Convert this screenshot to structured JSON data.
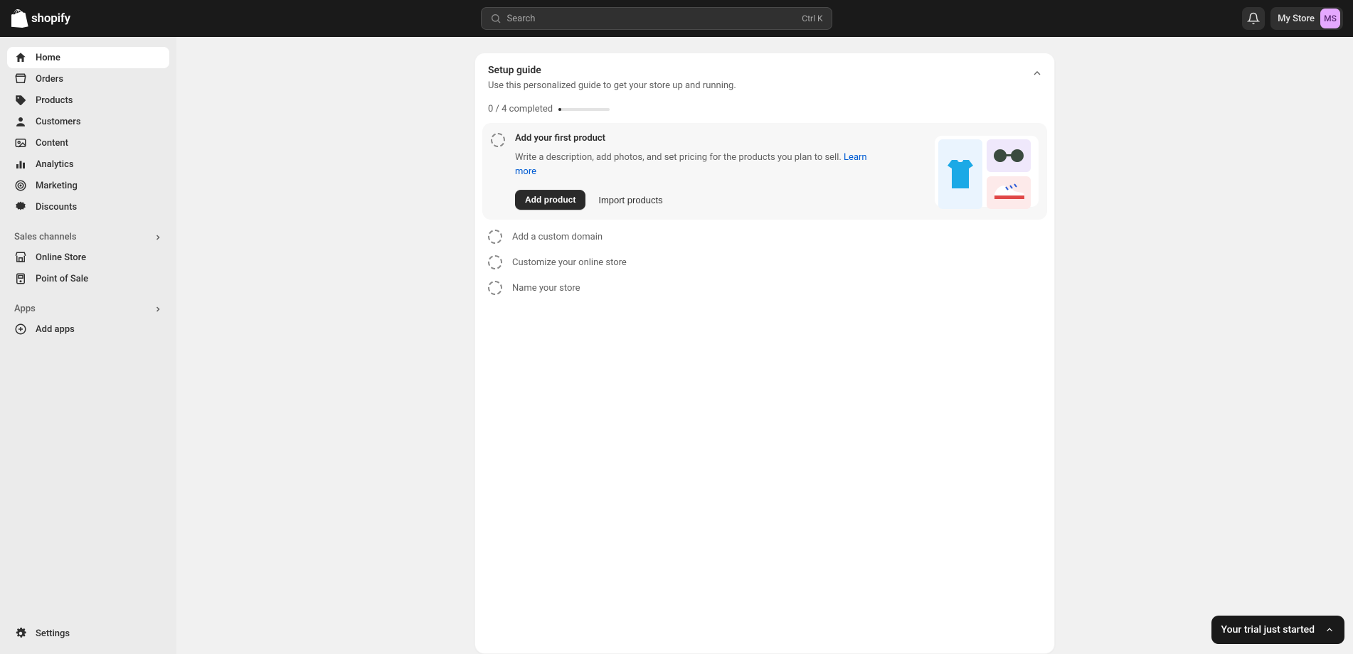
{
  "header": {
    "search_placeholder": "Search",
    "search_kbd": "Ctrl K",
    "store_name": "My Store",
    "avatar_initials": "MS"
  },
  "sidebar": {
    "nav": [
      {
        "label": "Home",
        "icon": "home",
        "active": true
      },
      {
        "label": "Orders",
        "icon": "orders"
      },
      {
        "label": "Products",
        "icon": "products"
      },
      {
        "label": "Customers",
        "icon": "customers"
      },
      {
        "label": "Content",
        "icon": "content"
      },
      {
        "label": "Analytics",
        "icon": "analytics"
      },
      {
        "label": "Marketing",
        "icon": "marketing"
      },
      {
        "label": "Discounts",
        "icon": "discounts"
      }
    ],
    "channels_header": "Sales channels",
    "channels": [
      {
        "label": "Online Store",
        "icon": "onlinestore"
      },
      {
        "label": "Point of Sale",
        "icon": "pos"
      }
    ],
    "apps_header": "Apps",
    "apps": [
      {
        "label": "Add apps",
        "icon": "addapps"
      }
    ],
    "settings_label": "Settings"
  },
  "setup": {
    "title": "Setup guide",
    "subtitle": "Use this personalized guide to get your store up and running.",
    "progress_text": "0 / 4 completed",
    "step1": {
      "title": "Add your first product",
      "desc": "Write a description, add photos, and set pricing for the products you plan to sell. ",
      "learn_more": "Learn more",
      "primary_btn": "Add product",
      "secondary_btn": "Import products"
    },
    "steps_collapsed": [
      "Add a custom domain",
      "Customize your online store",
      "Name your store"
    ]
  },
  "trial_toast": "Your trial just started"
}
